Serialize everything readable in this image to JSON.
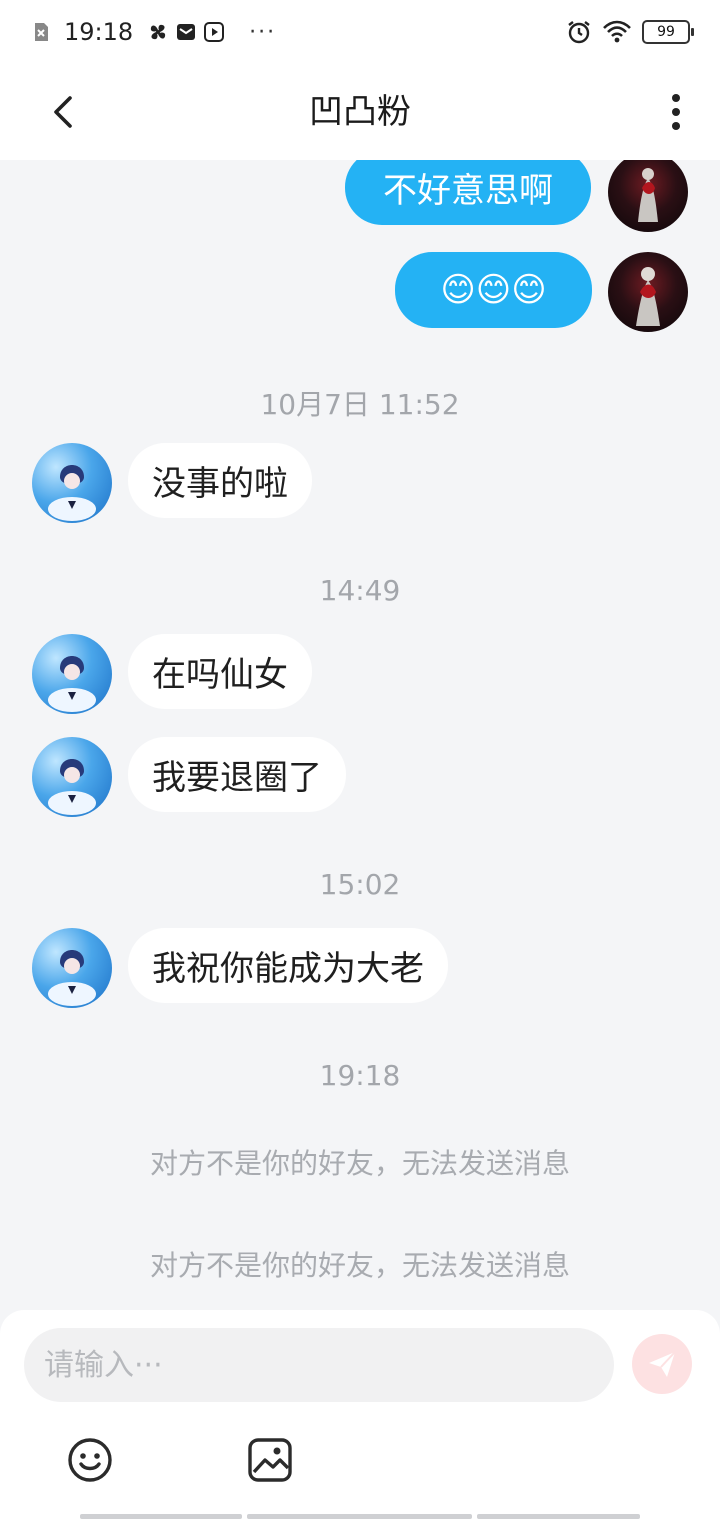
{
  "status_bar": {
    "time": "19:18",
    "dots": "···",
    "battery": "99"
  },
  "header": {
    "title": "凹凸粉"
  },
  "messages": {
    "mine": [
      {
        "text": "不好意思啊"
      },
      {
        "text": "😊😊😊"
      }
    ],
    "groups": [
      {
        "timestamp": "10月7日 11:52",
        "items": [
          "没事的啦"
        ]
      },
      {
        "timestamp": "14:49",
        "items": [
          "在吗仙女",
          "我要退圈了"
        ]
      },
      {
        "timestamp": "15:02",
        "items": [
          "我祝你能成为大老"
        ]
      },
      {
        "timestamp": "19:18"
      }
    ],
    "system": [
      "对方不是你的好友，无法发送消息",
      "对方不是你的好友，无法发送消息"
    ]
  },
  "composer": {
    "placeholder": "请输入···"
  },
  "colors": {
    "my_bubble": "#24b2f4",
    "their_bubble": "#ffffff",
    "background": "#f4f5f7",
    "send_button": "#fde1e2"
  },
  "icons": {
    "back": "chevron-left-icon",
    "more": "more-vertical-icon",
    "send": "paper-plane-icon",
    "emoji": "smiley-icon",
    "image": "image-icon"
  }
}
